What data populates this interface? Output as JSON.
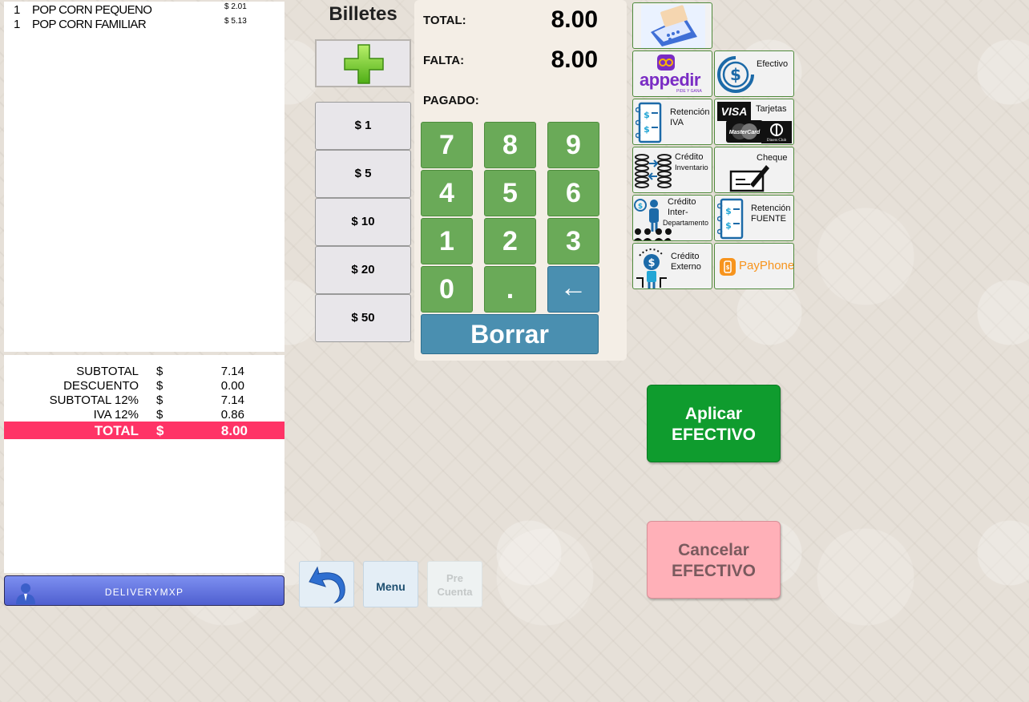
{
  "order": {
    "items": [
      {
        "qty": "1",
        "name": "POP CORN PEQUENO",
        "price": "$ 2.01"
      },
      {
        "qty": "1",
        "name": "POP CORN FAMILIAR",
        "price": "$ 5.13"
      }
    ]
  },
  "totals": {
    "rows": [
      {
        "label": "SUBTOTAL",
        "currency": "$",
        "value": "7.14"
      },
      {
        "label": "DESCUENTO",
        "currency": "$",
        "value": "0.00"
      },
      {
        "label": "SUBTOTAL 12%",
        "currency": "$",
        "value": "7.14"
      },
      {
        "label": "IVA 12%",
        "currency": "$",
        "value": "0.86"
      }
    ],
    "grand": {
      "label": "TOTAL",
      "currency": "$",
      "value": "8.00"
    }
  },
  "user": {
    "name": "DELIVERYMXP",
    "icon": "user-icon"
  },
  "bills": {
    "title": "Billetes",
    "add_icon": "plus-icon",
    "items": [
      "$ 1",
      "$ 5",
      "$ 10",
      "$ 20",
      "$ 50"
    ]
  },
  "payment": {
    "total_label": "TOTAL:",
    "total_value": "8.00",
    "missing_label": "FALTA:",
    "missing_value": "8.00",
    "paid_label": "PAGADO:"
  },
  "keypad": {
    "keys": [
      "7",
      "8",
      "9",
      "4",
      "5",
      "6",
      "1",
      "2",
      "3",
      "0",
      ".",
      "←"
    ],
    "clear_label": "Borrar"
  },
  "methods": {
    "card_reader": {
      "icon": "card-reader-icon"
    },
    "appedir": {
      "logo_text": "appedir",
      "tagline": "PIDE Y GANA"
    },
    "efectivo": {
      "label": "Efectivo",
      "icon": "dollar-coin-icon"
    },
    "retencion_iva": {
      "label1": "Retención",
      "label2": "IVA"
    },
    "tarjetas": {
      "label": "Tarjetas",
      "visa": "VISA",
      "mastercard": "MasterCard",
      "diners": "Diners Club"
    },
    "credito_inventario": {
      "label1": "Crédito",
      "label2": "Inventario"
    },
    "cheque": {
      "label": "Cheque"
    },
    "credito_inter": {
      "label1": "Crédito",
      "label2": "Inter-",
      "label3": "Departamento"
    },
    "retencion_fuente": {
      "label1": "Retención",
      "label2": "FUENTE"
    },
    "credito_externo": {
      "label1": "Crédito",
      "label2": "Externo"
    },
    "payphone": {
      "label": "PayPhone"
    }
  },
  "actions": {
    "apply_line1": "Aplicar",
    "apply_line2": "EFECTIVO",
    "cancel_line1": "Cancelar",
    "cancel_line2": "EFECTIVO",
    "undo_icon": "undo-icon",
    "menu_label": "Menu",
    "precuenta_line1": "Pre",
    "precuenta_line2": "Cuenta"
  },
  "colors": {
    "keypad_green": "#6aaa58",
    "keypad_blue": "#4a8fb0",
    "total_bar": "#ff3366",
    "apply_green": "#0f9c2e",
    "cancel_pink": "#ffb0b8"
  }
}
